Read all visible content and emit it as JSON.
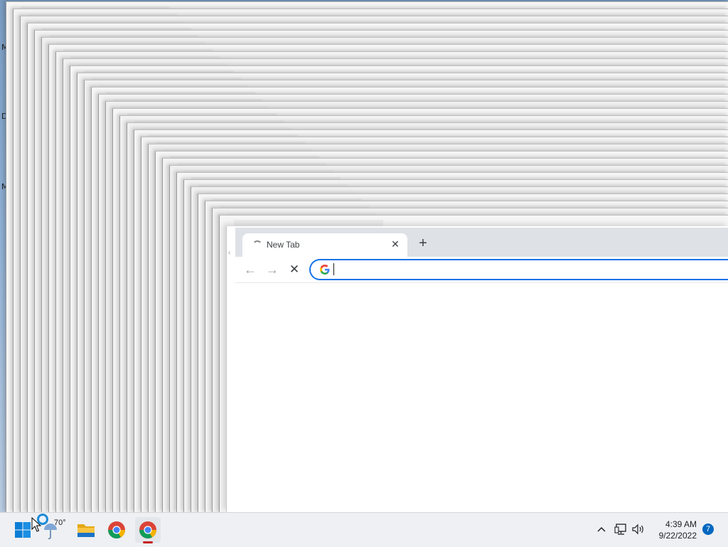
{
  "desktop": {
    "icon_labels": [
      "M",
      "D",
      "M"
    ]
  },
  "browser": {
    "tab": {
      "title": "New Tab",
      "close_glyph": "✕"
    },
    "new_tab_glyph": "+",
    "toolbar": {
      "back_glyph": "←",
      "forward_glyph": "→",
      "stop_glyph": "✕"
    },
    "omnibox": {
      "value": "",
      "placeholder": ""
    },
    "accent_color": "#1a73e8"
  },
  "taskbar": {
    "weather": {
      "temperature": "70°"
    },
    "tray": {
      "chevron_glyph": "^",
      "time": "4:39 AM",
      "date": "9/22/2022",
      "notification_count": "7"
    },
    "icons": [
      "windows-start-icon",
      "weather-icon",
      "file-explorer-icon",
      "chrome-icon",
      "chrome-icon",
      "network-icon",
      "volume-icon"
    ]
  }
}
